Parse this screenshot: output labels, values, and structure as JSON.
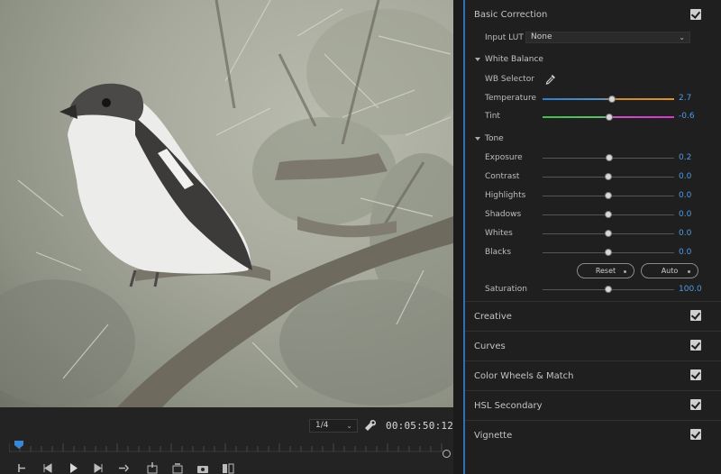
{
  "monitor": {
    "zoom": "1/4",
    "timecode": "00:05:50:12",
    "icons": [
      "wrench-icon",
      "mark-in-icon",
      "step-back-icon",
      "play-icon",
      "step-forward-icon",
      "go-to-out-icon",
      "insert-icon",
      "overwrite-icon",
      "export-frame-icon",
      "compare-icon"
    ]
  },
  "lumetri": {
    "accent": "#4f9be6",
    "basic_correction": {
      "title": "Basic Correction",
      "checked": true,
      "input_lut_label": "Input LUT",
      "input_lut_value": "None",
      "white_balance": {
        "title": "White Balance",
        "wb_selector_label": "WB Selector",
        "temperature": {
          "label": "Temperature",
          "value": "2.7",
          "fraction": 0.53
        },
        "tint": {
          "label": "Tint",
          "value": "-0.6",
          "fraction": 0.51
        }
      },
      "tone": {
        "title": "Tone",
        "sliders": [
          {
            "label": "Exposure",
            "value": "0.2",
            "fraction": 0.51
          },
          {
            "label": "Contrast",
            "value": "0.0",
            "fraction": 0.5
          },
          {
            "label": "Highlights",
            "value": "0.0",
            "fraction": 0.5
          },
          {
            "label": "Shadows",
            "value": "0.0",
            "fraction": 0.5
          },
          {
            "label": "Whites",
            "value": "0.0",
            "fraction": 0.5
          },
          {
            "label": "Blacks",
            "value": "0.0",
            "fraction": 0.5
          }
        ],
        "reset_label": "Reset",
        "auto_label": "Auto"
      },
      "saturation": {
        "label": "Saturation",
        "value": "100.0",
        "fraction": 0.5
      }
    },
    "sections": [
      {
        "title": "Creative",
        "checked": true
      },
      {
        "title": "Curves",
        "checked": true
      },
      {
        "title": "Color Wheels & Match",
        "checked": true
      },
      {
        "title": "HSL Secondary",
        "checked": true
      },
      {
        "title": "Vignette",
        "checked": true
      }
    ]
  }
}
